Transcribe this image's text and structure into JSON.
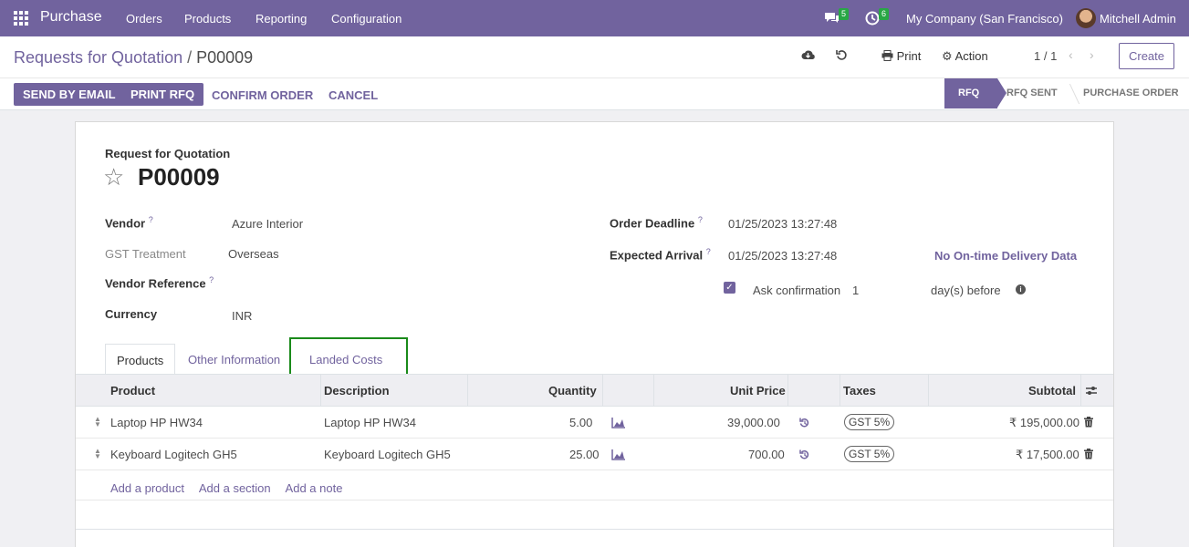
{
  "navbar": {
    "app_name": "Purchase",
    "menus": [
      "Orders",
      "Products",
      "Reporting",
      "Configuration"
    ],
    "messages_count": "5",
    "activities_count": "6",
    "company": "My Company (San Francisco)",
    "user": "Mitchell Admin",
    "bg_color": "#71639e"
  },
  "breadcrumb": {
    "parent": "Requests for Quotation",
    "separator": "/",
    "current": "P00009"
  },
  "control": {
    "print_label": "Print",
    "action_label": "Action",
    "pager": "1 / 1",
    "create_label": "Create"
  },
  "buttons": {
    "send_email": "SEND BY EMAIL",
    "print_rfq": "PRINT RFQ",
    "confirm": "CONFIRM ORDER",
    "cancel": "CANCEL"
  },
  "status": {
    "stages": [
      "RFQ",
      "RFQ SENT",
      "PURCHASE ORDER"
    ],
    "active": "RFQ"
  },
  "form": {
    "title_label": "Request for Quotation",
    "name": "P00009",
    "vendor_label": "Vendor",
    "vendor": "Azure Interior",
    "gst_label": "GST Treatment",
    "gst": "Overseas",
    "vendor_ref_label": "Vendor Reference",
    "currency_label": "Currency",
    "currency": "INR",
    "deadline_label": "Order Deadline",
    "deadline": "01/25/2023 13:27:48",
    "arrival_label": "Expected Arrival",
    "arrival": "01/25/2023 13:27:48",
    "no_delivery": "No On-time Delivery Data",
    "ask_label": "Ask confirmation",
    "ask_days": "1",
    "days_before": "day(s) before",
    "help_mark": "?"
  },
  "tabs": [
    "Products",
    "Other Information",
    "Landed Costs"
  ],
  "table": {
    "headers": {
      "product": "Product",
      "description": "Description",
      "quantity": "Quantity",
      "unit_price": "Unit Price",
      "taxes": "Taxes",
      "subtotal": "Subtotal"
    },
    "rows": [
      {
        "product": "Laptop HP HW34",
        "description": "Laptop HP HW34",
        "quantity": "5.00",
        "unit_price": "39,000.00",
        "tax": "GST 5%",
        "subtotal": "₹ 195,000.00"
      },
      {
        "product": "Keyboard Logitech GH5",
        "description": "Keyboard Logitech GH5",
        "quantity": "25.00",
        "unit_price": "700.00",
        "tax": "GST 5%",
        "subtotal": "₹ 17,500.00"
      }
    ],
    "add_product": "Add a product",
    "add_section": "Add a section",
    "add_note": "Add a note"
  }
}
